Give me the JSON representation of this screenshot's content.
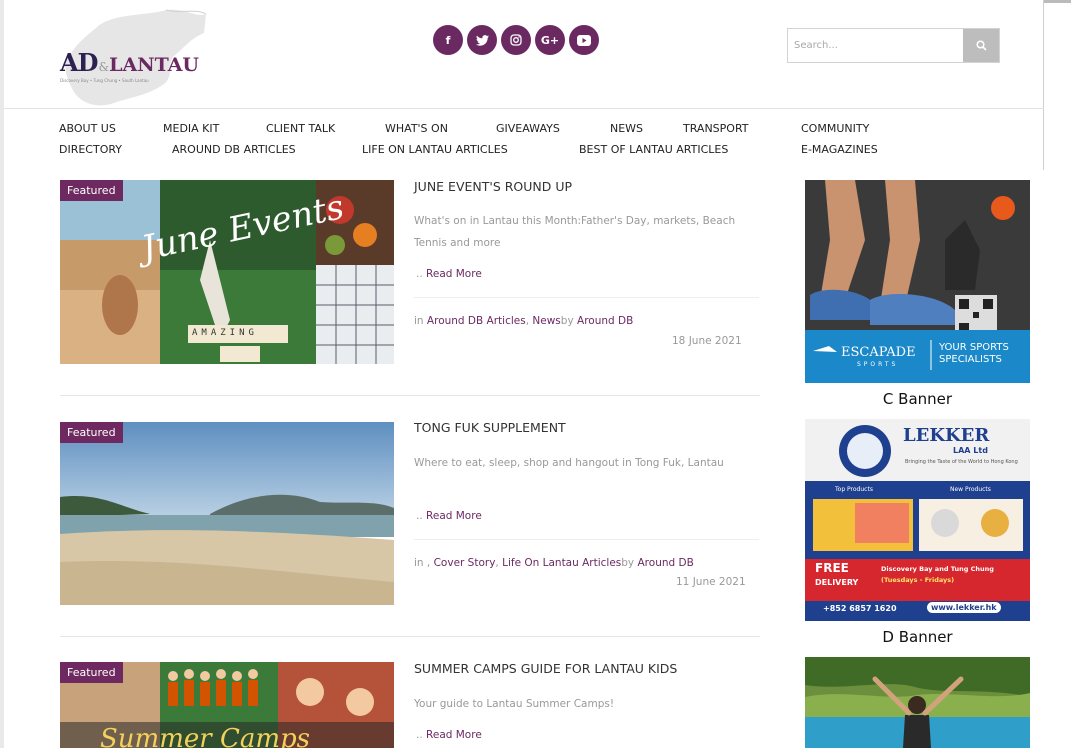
{
  "header": {
    "logo_main": "AD",
    "logo_amp": "&",
    "logo_lantau": "LANTAU",
    "logo_tagline": "Discovery Bay • Tung Chung • South Lantau",
    "socials": [
      {
        "icon": "facebook-icon",
        "glyph": "f"
      },
      {
        "icon": "twitter-icon",
        "glyph": "t"
      },
      {
        "icon": "instagram-icon",
        "glyph": "◎"
      },
      {
        "icon": "google-plus-icon",
        "glyph": "G+"
      },
      {
        "icon": "youtube-icon",
        "glyph": "▶"
      }
    ],
    "search_placeholder": "Search..."
  },
  "nav": {
    "about": "ABOUT US",
    "media": "MEDIA KIT",
    "client": "CLIENT TALK",
    "whats": "WHAT'S ON",
    "give": "GIVEAWAYS",
    "news": "NEWS",
    "transport": "TRANSPORT",
    "community": "COMMUNITY",
    "directory": "DIRECTORY",
    "arounddb": "AROUND DB ARTICLES",
    "life": "LIFE ON LANTAU ARTICLES",
    "best": "BEST OF LANTAU ARTICLES",
    "emag": "E-MAGAZINES"
  },
  "posts": [
    {
      "badge": "Featured",
      "title": "JUNE EVENT'S ROUND UP",
      "excerpt": "What's on in Lantau this Month:Father's Day, markets, Beach Tennis and more",
      "read_more": "Read More",
      "meta_prefix": "in",
      "cat1": "Around DB Articles",
      "cat2": "News",
      "by": "by",
      "author": "Around DB",
      "date": "18 June 2021",
      "img_text": "June Events",
      "tiles": "AMAZING"
    },
    {
      "badge": "Featured",
      "title": "TONG FUK SUPPLEMENT",
      "excerpt": "Where to eat, sleep, shop and hangout in Tong Fuk, Lantau",
      "read_more": "Read More",
      "meta_prefix": "in ,",
      "cat1": "Cover Story",
      "cat2": "Life On Lantau Articles",
      "by": "by",
      "author": "Around DB",
      "date": "11 June 2021"
    },
    {
      "badge": "Featured",
      "title": "SUMMER CAMPS GUIDE FOR LANTAU KIDS",
      "excerpt": "Your guide to Lantau Summer Camps!",
      "read_more": "Read More",
      "img_text": "Summer Camps"
    }
  ],
  "sidebar": {
    "ad1": {
      "brand": "ESCAPADE",
      "sub": "SPORTS",
      "slogan1": "YOUR SPORTS",
      "slogan2": "SPECIALISTS"
    },
    "caption1": "C Banner",
    "ad2": {
      "brand": "LEKKER",
      "sub": "LAA Ltd",
      "tag": "Bringing the Taste of the World to Hong Kong",
      "top": "Top Products",
      "new": "New Products",
      "free": "FREE",
      "delivery": "DELIVERY",
      "area": "Discovery Bay and Tung Chung",
      "days": "(Tuesdays - Fridays)",
      "phone": "+852 6857 1620",
      "url": "www.lekker.hk"
    },
    "caption2": "D Banner"
  },
  "colors": {
    "accent": "#6a2a61",
    "badge": "#6e2a60",
    "escapade": "#1a88c9",
    "lekker_blue": "#1f3f8f",
    "lekker_red": "#d6262e"
  }
}
